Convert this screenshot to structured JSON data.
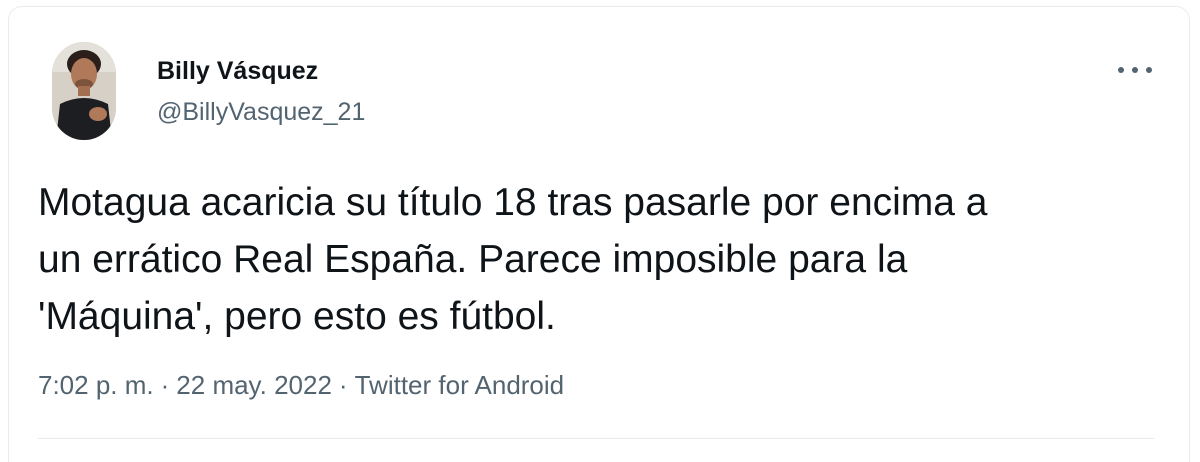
{
  "tweet": {
    "author_name": "Billy Vásquez",
    "author_handle": "@BillyVasquez_21",
    "text": "Motagua acaricia su título 18 tras pasarle por encima a\nun errático Real España. Parece imposible para la\n'Máquina', pero esto es fútbol.",
    "time": "7:02 p. m.",
    "date": "22 may. 2022",
    "source": "Twitter for Android",
    "separator": "·"
  },
  "icons": {
    "more": "more-horizontal-icon"
  },
  "colors": {
    "text_primary": "#0f1419",
    "text_secondary": "#536471",
    "border": "#e6ecf0"
  }
}
